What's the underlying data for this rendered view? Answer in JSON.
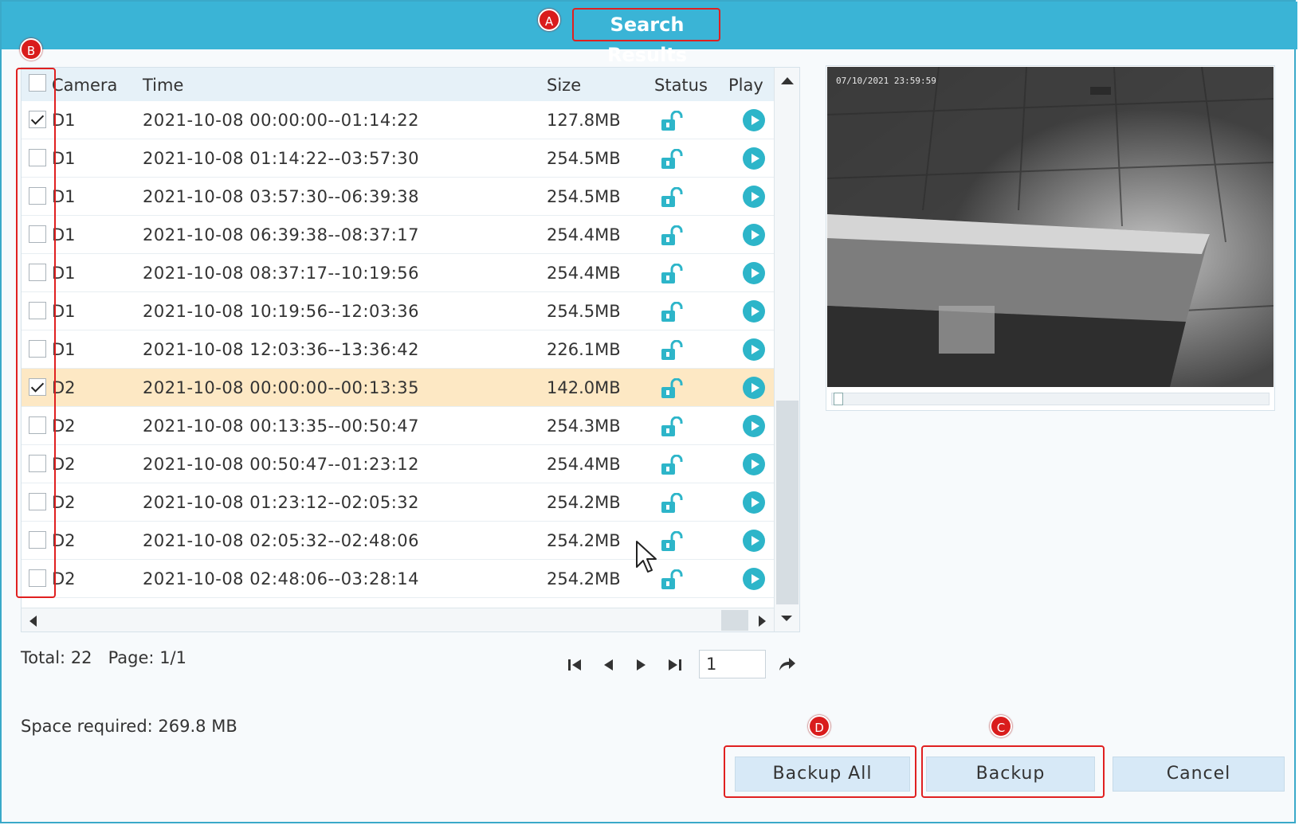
{
  "window": {
    "title": "Search Results"
  },
  "annotations": [
    "A",
    "B",
    "C",
    "D"
  ],
  "table": {
    "headers": [
      "Camera",
      "Time",
      "Size",
      "Status",
      "Play"
    ],
    "rows": [
      {
        "camera": "D1",
        "time": "2021-10-08 00:00:00--01:14:22",
        "size": "127.8MB",
        "checked": true,
        "selected": false
      },
      {
        "camera": "D1",
        "time": "2021-10-08 01:14:22--03:57:30",
        "size": "254.5MB",
        "checked": false,
        "selected": false
      },
      {
        "camera": "D1",
        "time": "2021-10-08 03:57:30--06:39:38",
        "size": "254.5MB",
        "checked": false,
        "selected": false
      },
      {
        "camera": "D1",
        "time": "2021-10-08 06:39:38--08:37:17",
        "size": "254.4MB",
        "checked": false,
        "selected": false
      },
      {
        "camera": "D1",
        "time": "2021-10-08 08:37:17--10:19:56",
        "size": "254.4MB",
        "checked": false,
        "selected": false
      },
      {
        "camera": "D1",
        "time": "2021-10-08 10:19:56--12:03:36",
        "size": "254.5MB",
        "checked": false,
        "selected": false
      },
      {
        "camera": "D1",
        "time": "2021-10-08 12:03:36--13:36:42",
        "size": "226.1MB",
        "checked": false,
        "selected": false
      },
      {
        "camera": "D2",
        "time": "2021-10-08 00:00:00--00:13:35",
        "size": "142.0MB",
        "checked": true,
        "selected": true
      },
      {
        "camera": "D2",
        "time": "2021-10-08 00:13:35--00:50:47",
        "size": "254.3MB",
        "checked": false,
        "selected": false
      },
      {
        "camera": "D2",
        "time": "2021-10-08 00:50:47--01:23:12",
        "size": "254.4MB",
        "checked": false,
        "selected": false
      },
      {
        "camera": "D2",
        "time": "2021-10-08 01:23:12--02:05:32",
        "size": "254.2MB",
        "checked": false,
        "selected": false
      },
      {
        "camera": "D2",
        "time": "2021-10-08 02:05:32--02:48:06",
        "size": "254.2MB",
        "checked": false,
        "selected": false
      },
      {
        "camera": "D2",
        "time": "2021-10-08 02:48:06--03:28:14",
        "size": "254.2MB",
        "checked": false,
        "selected": false
      }
    ],
    "status_icon": "unlock-icon",
    "play_icon": "play-icon"
  },
  "pagination": {
    "total_label": "Total:",
    "total": "22",
    "page_label": "Page:",
    "page": "1/1",
    "page_input": "1"
  },
  "space_required": "Space required: 269.8 MB",
  "preview": {
    "timestamp": "07/10/2021 23:59:59"
  },
  "buttons": {
    "backup_all": "Backup All",
    "backup": "Backup",
    "cancel": "Cancel"
  },
  "colors": {
    "titlebar": "#3ab4d6",
    "accent": "#2db5c9",
    "annotation": "#d91c1c",
    "selected_row": "#fde8c4"
  }
}
